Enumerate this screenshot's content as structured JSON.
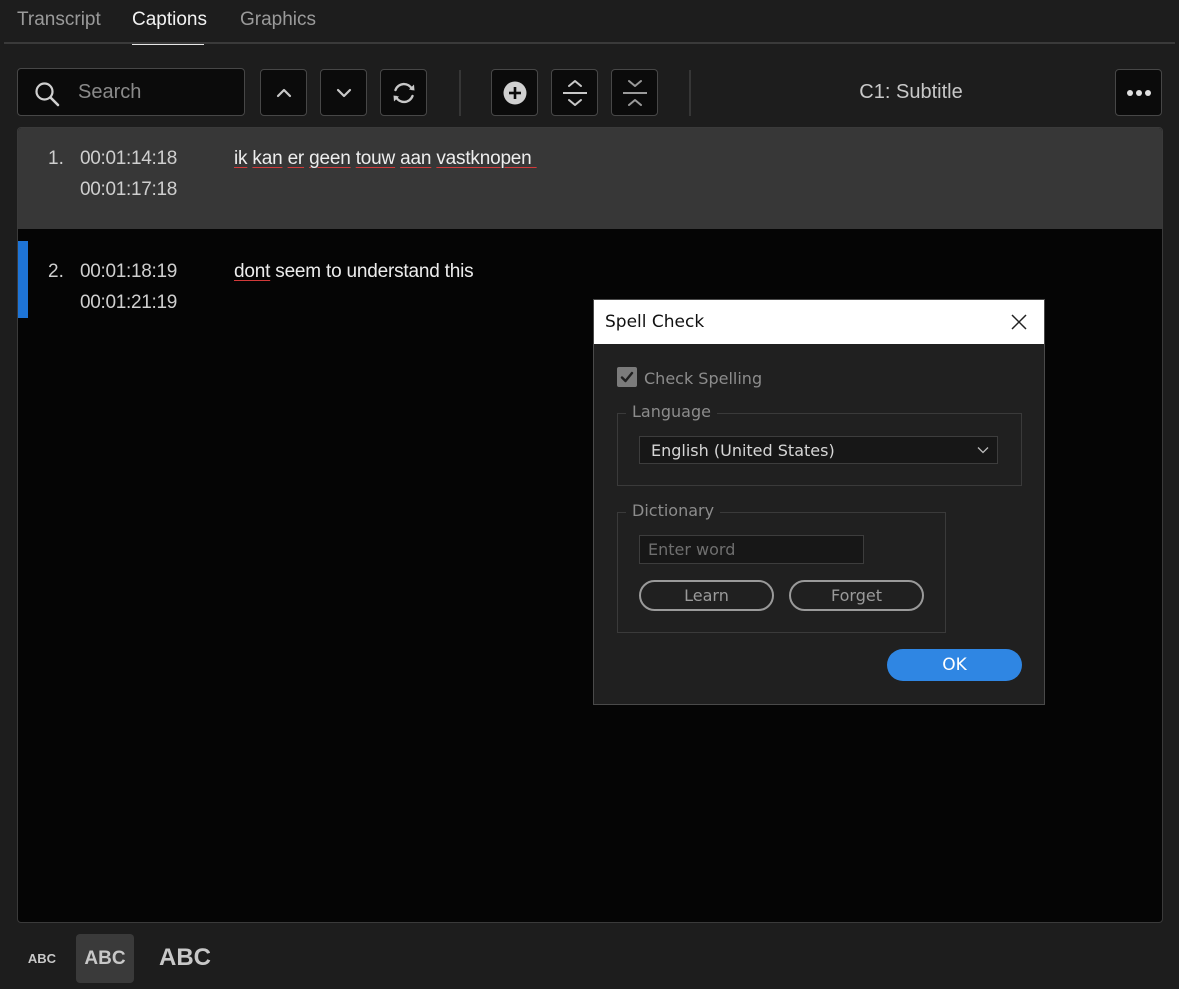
{
  "tabs": [
    {
      "label": "Transcript"
    },
    {
      "label": "Captions"
    },
    {
      "label": "Graphics"
    }
  ],
  "active_tab": "Captions",
  "toolbar": {
    "search_placeholder": "Search",
    "search_value": "",
    "buttons": [
      "chevron-up-icon",
      "chevron-down-icon",
      "refresh-icon",
      "add-caption-icon",
      "split-caption-icon",
      "merge-caption-icon",
      "more-icon"
    ],
    "track_label": "C1: Subtitle"
  },
  "captions": [
    {
      "number": "1.",
      "time_in": "00:01:14:18",
      "time_out": "00:01:17:18",
      "words": [
        "ik",
        "kan",
        "er",
        "geen",
        "touw",
        "aan",
        "vastknopen"
      ],
      "misspelled_all": true,
      "selected": true
    },
    {
      "number": "2.",
      "time_in": "00:01:18:19",
      "time_out": "00:01:21:19",
      "misspelled_word": "dont",
      "rest_text": " seem to understand this",
      "selected": false
    }
  ],
  "text_sizes": {
    "small": "ABC",
    "medium": "ABC",
    "large": "ABC",
    "selected": "medium"
  },
  "spell_check_dialog": {
    "title": "Spell Check",
    "check_spelling_label": "Check Spelling",
    "check_spelling_checked": true,
    "language_group_label": "Language",
    "language_value": "English (United States)",
    "dictionary_group_label": "Dictionary",
    "word_placeholder": "Enter word",
    "learn_label": "Learn",
    "forget_label": "Forget",
    "ok_label": "OK"
  },
  "colors": {
    "accent": "#2f86e3",
    "selection_marker": "#1e74d6",
    "misspelling_underline": "#d23a3a"
  }
}
